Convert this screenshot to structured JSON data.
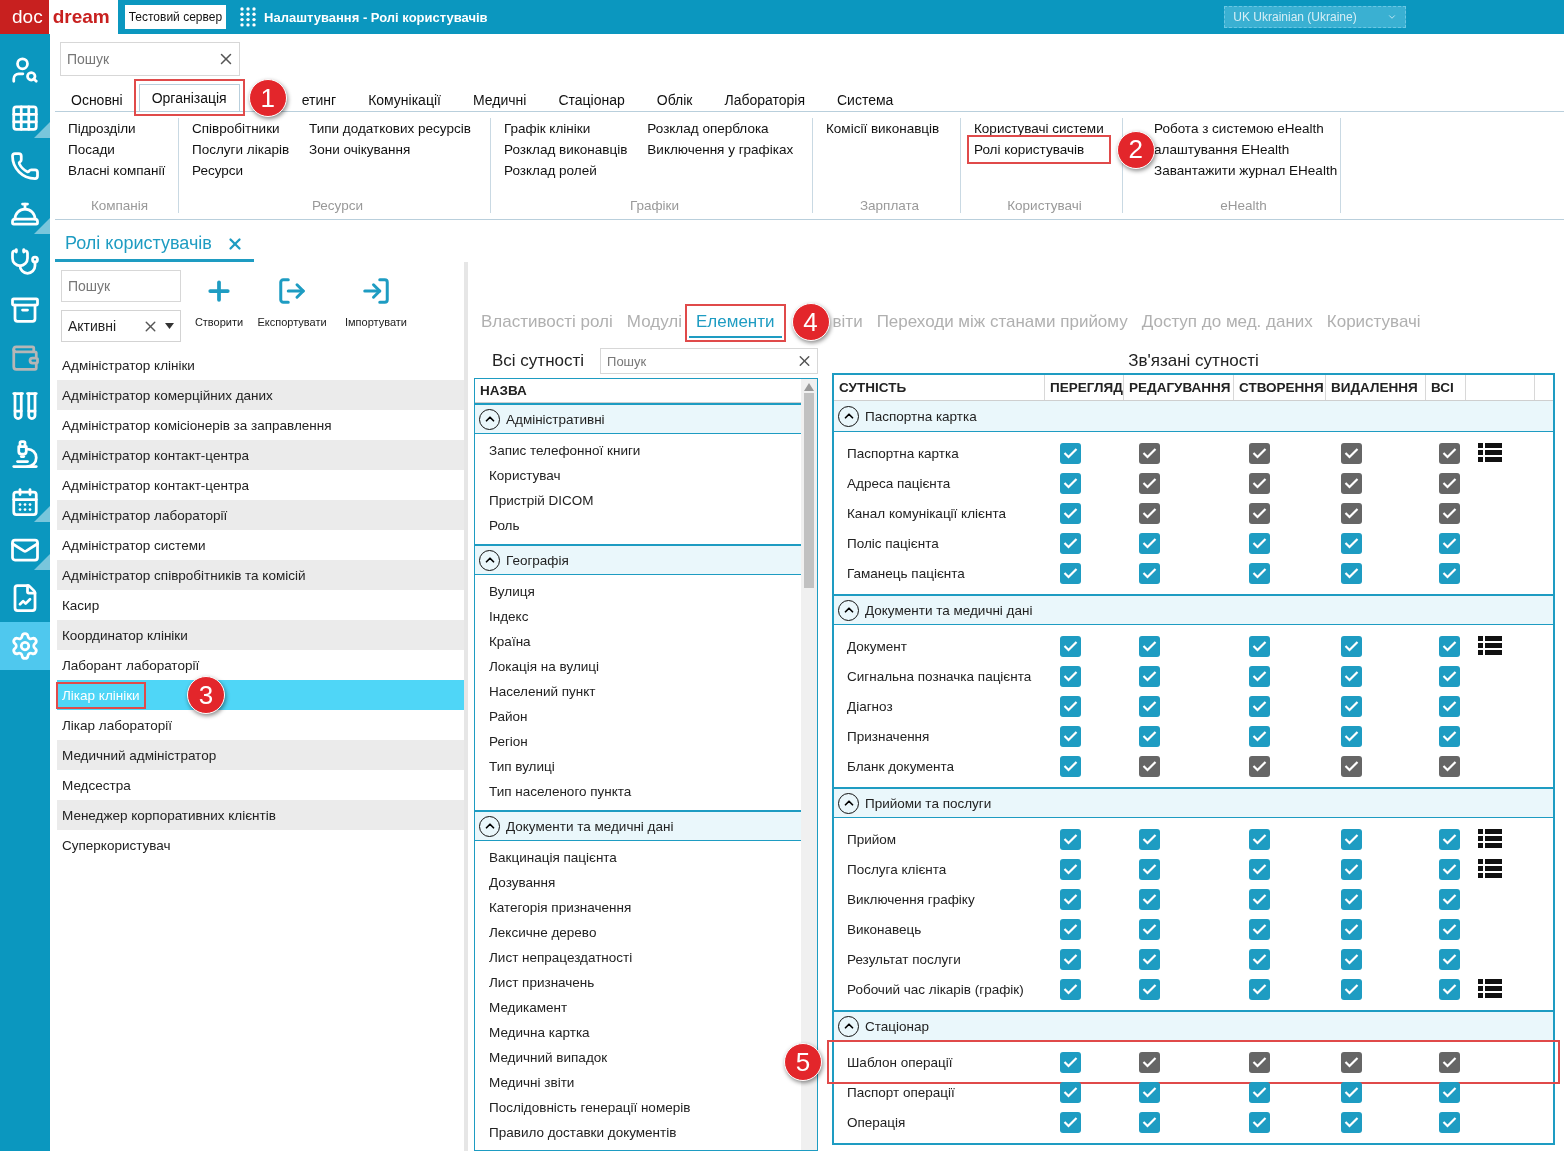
{
  "header": {
    "logo_left": "doc",
    "logo_right": "dream",
    "server": "Тестовий сервер",
    "title": "Налаштування - Ролі користувачів",
    "language": "UK Ukrainian (Ukraine)"
  },
  "sidebar": {
    "items": [
      {
        "kind": "user-search",
        "selected": false,
        "submenu": false
      },
      {
        "kind": "grid",
        "selected": false,
        "submenu": true
      },
      {
        "kind": "phone",
        "selected": false,
        "submenu": false
      },
      {
        "kind": "bell",
        "selected": false,
        "submenu": true
      },
      {
        "kind": "doctor",
        "selected": false,
        "submenu": false
      },
      {
        "kind": "archive",
        "selected": false,
        "submenu": false
      },
      {
        "kind": "wallet",
        "selected": false,
        "submenu": false
      },
      {
        "kind": "tubes",
        "selected": false,
        "submenu": false
      },
      {
        "kind": "microscope",
        "selected": false,
        "submenu": false
      },
      {
        "kind": "calendar",
        "selected": false,
        "submenu": true
      },
      {
        "kind": "mail",
        "selected": false,
        "submenu": true
      },
      {
        "kind": "report",
        "selected": false,
        "submenu": false
      },
      {
        "kind": "settings",
        "selected": true,
        "submenu": false
      }
    ]
  },
  "global_search": {
    "placeholder": "Пошук"
  },
  "ribbon_tabs": [
    {
      "label": "Основні",
      "selected": false
    },
    {
      "label": "Організація",
      "selected": true,
      "callout": "1"
    },
    {
      "label": "етинг",
      "selected": false
    },
    {
      "label": "Комунікації",
      "selected": false
    },
    {
      "label": "Медичні",
      "selected": false
    },
    {
      "label": "Стаціонар",
      "selected": false
    },
    {
      "label": "Облік",
      "selected": false
    },
    {
      "label": "Лабораторія",
      "selected": false
    },
    {
      "label": "Система",
      "selected": false
    }
  ],
  "ribbon_groups": [
    {
      "title": "Компанія",
      "columns": [
        [
          {
            "label": "Підрозділи"
          },
          {
            "label": "Посади"
          },
          {
            "label": "Власні компанії"
          }
        ]
      ]
    },
    {
      "title": "Ресурси",
      "columns": [
        [
          {
            "label": "Співробітники"
          },
          {
            "label": "Послуги лікарів"
          },
          {
            "label": "Ресурси"
          }
        ],
        [
          {
            "label": "Типи додаткових ресурсів"
          },
          {
            "label": "Зони очікування"
          }
        ]
      ]
    },
    {
      "title": "Графіки",
      "columns": [
        [
          {
            "label": "Графік клініки"
          },
          {
            "label": "Розклад виконавців"
          },
          {
            "label": "Розклад ролей"
          }
        ],
        [
          {
            "label": "Розклад оперблока"
          },
          {
            "label": "Виключення у графіках"
          }
        ]
      ]
    },
    {
      "title": "Зарплата",
      "columns": [
        [
          {
            "label": "Комісії виконавців"
          }
        ]
      ]
    },
    {
      "title": "Користувачі",
      "columns": [
        [
          {
            "label": "Користувачі системи"
          },
          {
            "label": "Ролі користувачів",
            "callout": "2"
          }
        ]
      ]
    },
    {
      "title": "eHealth",
      "columns": [
        [
          {
            "label": "Робота з системою eHealth"
          },
          {
            "label": "алаштування EHealth"
          },
          {
            "label": "Завантажити журнал EHealth"
          }
        ]
      ]
    }
  ],
  "document_tab": {
    "label": "Ролі користувачів"
  },
  "roles": {
    "search": {
      "placeholder": "Пошук"
    },
    "filter": {
      "value": "Активні"
    },
    "actions": [
      {
        "kind": "create",
        "label": "Створити"
      },
      {
        "kind": "export",
        "label": "Експортувати"
      },
      {
        "kind": "import",
        "label": "Імпортувати"
      }
    ],
    "items": [
      {
        "label": "Адміністратор клініки",
        "selected": false
      },
      {
        "label": "Адміністратор комерційних даних",
        "selected": false
      },
      {
        "label": "Адміністратор комісіонерів за заправлення",
        "selected": false
      },
      {
        "label": "Адміністратор контакт-центра",
        "selected": false
      },
      {
        "label": "Адміністратор контакт-центра",
        "selected": false
      },
      {
        "label": "Адміністратор лабораторії",
        "selected": false
      },
      {
        "label": "Адміністратор системи",
        "selected": false
      },
      {
        "label": "Адміністратор співробітників та комісій",
        "selected": false
      },
      {
        "label": "Касир",
        "selected": false
      },
      {
        "label": "Координатор клініки",
        "selected": false
      },
      {
        "label": "Лаборант лабораторії",
        "selected": false
      },
      {
        "label": "Лікар клініки",
        "selected": true,
        "callout": "3"
      },
      {
        "label": "Лікар лабораторії",
        "selected": false
      },
      {
        "label": "Медичний адміністратор",
        "selected": false
      },
      {
        "label": "Медсестра",
        "selected": false
      },
      {
        "label": "Менеджер корпоративних клієнтів",
        "selected": false
      },
      {
        "label": "Суперкористувач",
        "selected": false
      }
    ]
  },
  "role_tabs": [
    {
      "label": "Властивості ролі",
      "selected": false
    },
    {
      "label": "Модулі",
      "selected": false
    },
    {
      "label": "Елементи",
      "selected": true,
      "callout": "4"
    },
    {
      "label": "віти",
      "selected": false
    },
    {
      "label": "Переходи між станами прийому",
      "selected": false
    },
    {
      "label": "Доступ до мед. даних",
      "selected": false
    },
    {
      "label": "Користувачі",
      "selected": false
    }
  ],
  "entities": {
    "title": "Всі сутності",
    "search": {
      "placeholder": "Пошук"
    },
    "column": "НАЗВА",
    "groups": [
      {
        "label": "Адміністративні",
        "expanded": true,
        "children": [
          "Запис телефонної книги",
          "Користувач",
          "Пристрій DICOM",
          "Роль"
        ]
      },
      {
        "label": "Географія",
        "expanded": true,
        "children": [
          "Вулиця",
          "Індекс",
          "Країна",
          "Локація на вулиці",
          "Населений пункт",
          "Район",
          "Регіон",
          "Тип вулиці",
          "Тип населеного пункта"
        ]
      },
      {
        "label": "Документи та медичні дані",
        "expanded": true,
        "children": [
          "Вакцинація пацієнта",
          "Дозування",
          "Категорія призначення",
          "Лексичне дерево",
          "Лист непрацездатності",
          "Лист призначень",
          "Медикамент",
          "Медична картка",
          "Медичний випадок",
          "Медичні звіти",
          "Послідовність генерації номерів",
          "Правило доставки документів"
        ]
      }
    ]
  },
  "relations": {
    "title": "Зв'язані сутності",
    "columns": [
      "СУТНІСТЬ",
      "ПЕРЕГЛЯД",
      "РЕДАГУВАННЯ",
      "СТВОРЕННЯ",
      "ВИДАЛЕННЯ",
      "ВСІ"
    ],
    "groups": [
      {
        "label": "Паспортна картка",
        "expanded": true,
        "rows": [
          {
            "name": "Паспортна картка",
            "details": true,
            "cells": [
              {
                "checked": true,
                "disabled": false
              },
              {
                "checked": true,
                "disabled": true
              },
              {
                "checked": true,
                "disabled": true
              },
              {
                "checked": true,
                "disabled": true
              },
              {
                "checked": true,
                "disabled": true
              }
            ]
          },
          {
            "name": "Адреса пацієнта",
            "details": false,
            "cells": [
              {
                "checked": true,
                "disabled": false
              },
              {
                "checked": true,
                "disabled": true
              },
              {
                "checked": true,
                "disabled": true
              },
              {
                "checked": true,
                "disabled": true
              },
              {
                "checked": true,
                "disabled": true
              }
            ]
          },
          {
            "name": "Канал комунікації клієнта",
            "details": false,
            "cells": [
              {
                "checked": true,
                "disabled": false
              },
              {
                "checked": true,
                "disabled": true
              },
              {
                "checked": true,
                "disabled": true
              },
              {
                "checked": true,
                "disabled": true
              },
              {
                "checked": true,
                "disabled": true
              }
            ]
          },
          {
            "name": "Поліс пацієнта",
            "details": false,
            "cells": [
              {
                "checked": true,
                "disabled": false
              },
              {
                "checked": true,
                "disabled": false
              },
              {
                "checked": true,
                "disabled": false
              },
              {
                "checked": true,
                "disabled": false
              },
              {
                "checked": true,
                "disabled": false
              }
            ]
          },
          {
            "name": "Гаманець пацієнта",
            "details": false,
            "cells": [
              {
                "checked": true,
                "disabled": false
              },
              {
                "checked": true,
                "disabled": false
              },
              {
                "checked": true,
                "disabled": false
              },
              {
                "checked": true,
                "disabled": false
              },
              {
                "checked": true,
                "disabled": false
              }
            ]
          }
        ]
      },
      {
        "label": "Документи та медичні дані",
        "expanded": true,
        "rows": [
          {
            "name": "Документ",
            "details": true,
            "cells": [
              {
                "checked": true,
                "disabled": false
              },
              {
                "checked": true,
                "disabled": false
              },
              {
                "checked": true,
                "disabled": false
              },
              {
                "checked": true,
                "disabled": false
              },
              {
                "checked": true,
                "disabled": false
              }
            ]
          },
          {
            "name": "Сигнальна позначка пацієнта",
            "details": false,
            "cells": [
              {
                "checked": true,
                "disabled": false
              },
              {
                "checked": true,
                "disabled": false
              },
              {
                "checked": true,
                "disabled": false
              },
              {
                "checked": true,
                "disabled": false
              },
              {
                "checked": true,
                "disabled": false
              }
            ]
          },
          {
            "name": "Діагноз",
            "details": false,
            "cells": [
              {
                "checked": true,
                "disabled": false
              },
              {
                "checked": true,
                "disabled": false
              },
              {
                "checked": true,
                "disabled": false
              },
              {
                "checked": true,
                "disabled": false
              },
              {
                "checked": true,
                "disabled": false
              }
            ]
          },
          {
            "name": "Призначення",
            "details": false,
            "cells": [
              {
                "checked": true,
                "disabled": false
              },
              {
                "checked": true,
                "disabled": false
              },
              {
                "checked": true,
                "disabled": false
              },
              {
                "checked": true,
                "disabled": false
              },
              {
                "checked": true,
                "disabled": false
              }
            ]
          },
          {
            "name": "Бланк документа",
            "details": false,
            "cells": [
              {
                "checked": true,
                "disabled": false
              },
              {
                "checked": true,
                "disabled": true
              },
              {
                "checked": true,
                "disabled": true
              },
              {
                "checked": true,
                "disabled": true
              },
              {
                "checked": true,
                "disabled": true
              }
            ]
          }
        ]
      },
      {
        "label": "Прийоми та послуги",
        "expanded": true,
        "rows": [
          {
            "name": "Прийом",
            "details": true,
            "cells": [
              {
                "checked": true,
                "disabled": false
              },
              {
                "checked": true,
                "disabled": false
              },
              {
                "checked": true,
                "disabled": false
              },
              {
                "checked": true,
                "disabled": false
              },
              {
                "checked": true,
                "disabled": false
              }
            ]
          },
          {
            "name": "Послуга клієнта",
            "details": true,
            "cells": [
              {
                "checked": true,
                "disabled": false
              },
              {
                "checked": true,
                "disabled": false
              },
              {
                "checked": true,
                "disabled": false
              },
              {
                "checked": true,
                "disabled": false
              },
              {
                "checked": true,
                "disabled": false
              }
            ]
          },
          {
            "name": "Виключення графіку",
            "details": false,
            "cells": [
              {
                "checked": true,
                "disabled": false
              },
              {
                "checked": true,
                "disabled": false
              },
              {
                "checked": true,
                "disabled": false
              },
              {
                "checked": true,
                "disabled": false
              },
              {
                "checked": true,
                "disabled": false
              }
            ]
          },
          {
            "name": "Виконавець",
            "details": false,
            "cells": [
              {
                "checked": true,
                "disabled": false
              },
              {
                "checked": true,
                "disabled": false
              },
              {
                "checked": true,
                "disabled": false
              },
              {
                "checked": true,
                "disabled": false
              },
              {
                "checked": true,
                "disabled": false
              }
            ]
          },
          {
            "name": "Результат послуги",
            "details": false,
            "cells": [
              {
                "checked": true,
                "disabled": false
              },
              {
                "checked": true,
                "disabled": false
              },
              {
                "checked": true,
                "disabled": false
              },
              {
                "checked": true,
                "disabled": false
              },
              {
                "checked": true,
                "disabled": false
              }
            ]
          },
          {
            "name": "Робочий час лікарів (графік)",
            "details": true,
            "cells": [
              {
                "checked": true,
                "disabled": false
              },
              {
                "checked": true,
                "disabled": false
              },
              {
                "checked": true,
                "disabled": false
              },
              {
                "checked": true,
                "disabled": false
              },
              {
                "checked": true,
                "disabled": false
              }
            ]
          }
        ]
      },
      {
        "label": "Стаціонар",
        "expanded": true,
        "rows": [
          {
            "name": "Шаблон операції",
            "details": false,
            "callout": "5",
            "cells": [
              {
                "checked": true,
                "disabled": false
              },
              {
                "checked": true,
                "disabled": true
              },
              {
                "checked": true,
                "disabled": true
              },
              {
                "checked": true,
                "disabled": true
              },
              {
                "checked": true,
                "disabled": true
              }
            ]
          },
          {
            "name": "Паспорт операції",
            "details": false,
            "cells": [
              {
                "checked": true,
                "disabled": false
              },
              {
                "checked": true,
                "disabled": false
              },
              {
                "checked": true,
                "disabled": false
              },
              {
                "checked": true,
                "disabled": false
              },
              {
                "checked": true,
                "disabled": false
              }
            ]
          },
          {
            "name": "Операція",
            "details": false,
            "cells": [
              {
                "checked": true,
                "disabled": false
              },
              {
                "checked": true,
                "disabled": false
              },
              {
                "checked": true,
                "disabled": false
              },
              {
                "checked": true,
                "disabled": false
              },
              {
                "checked": true,
                "disabled": false
              }
            ]
          }
        ]
      }
    ]
  }
}
